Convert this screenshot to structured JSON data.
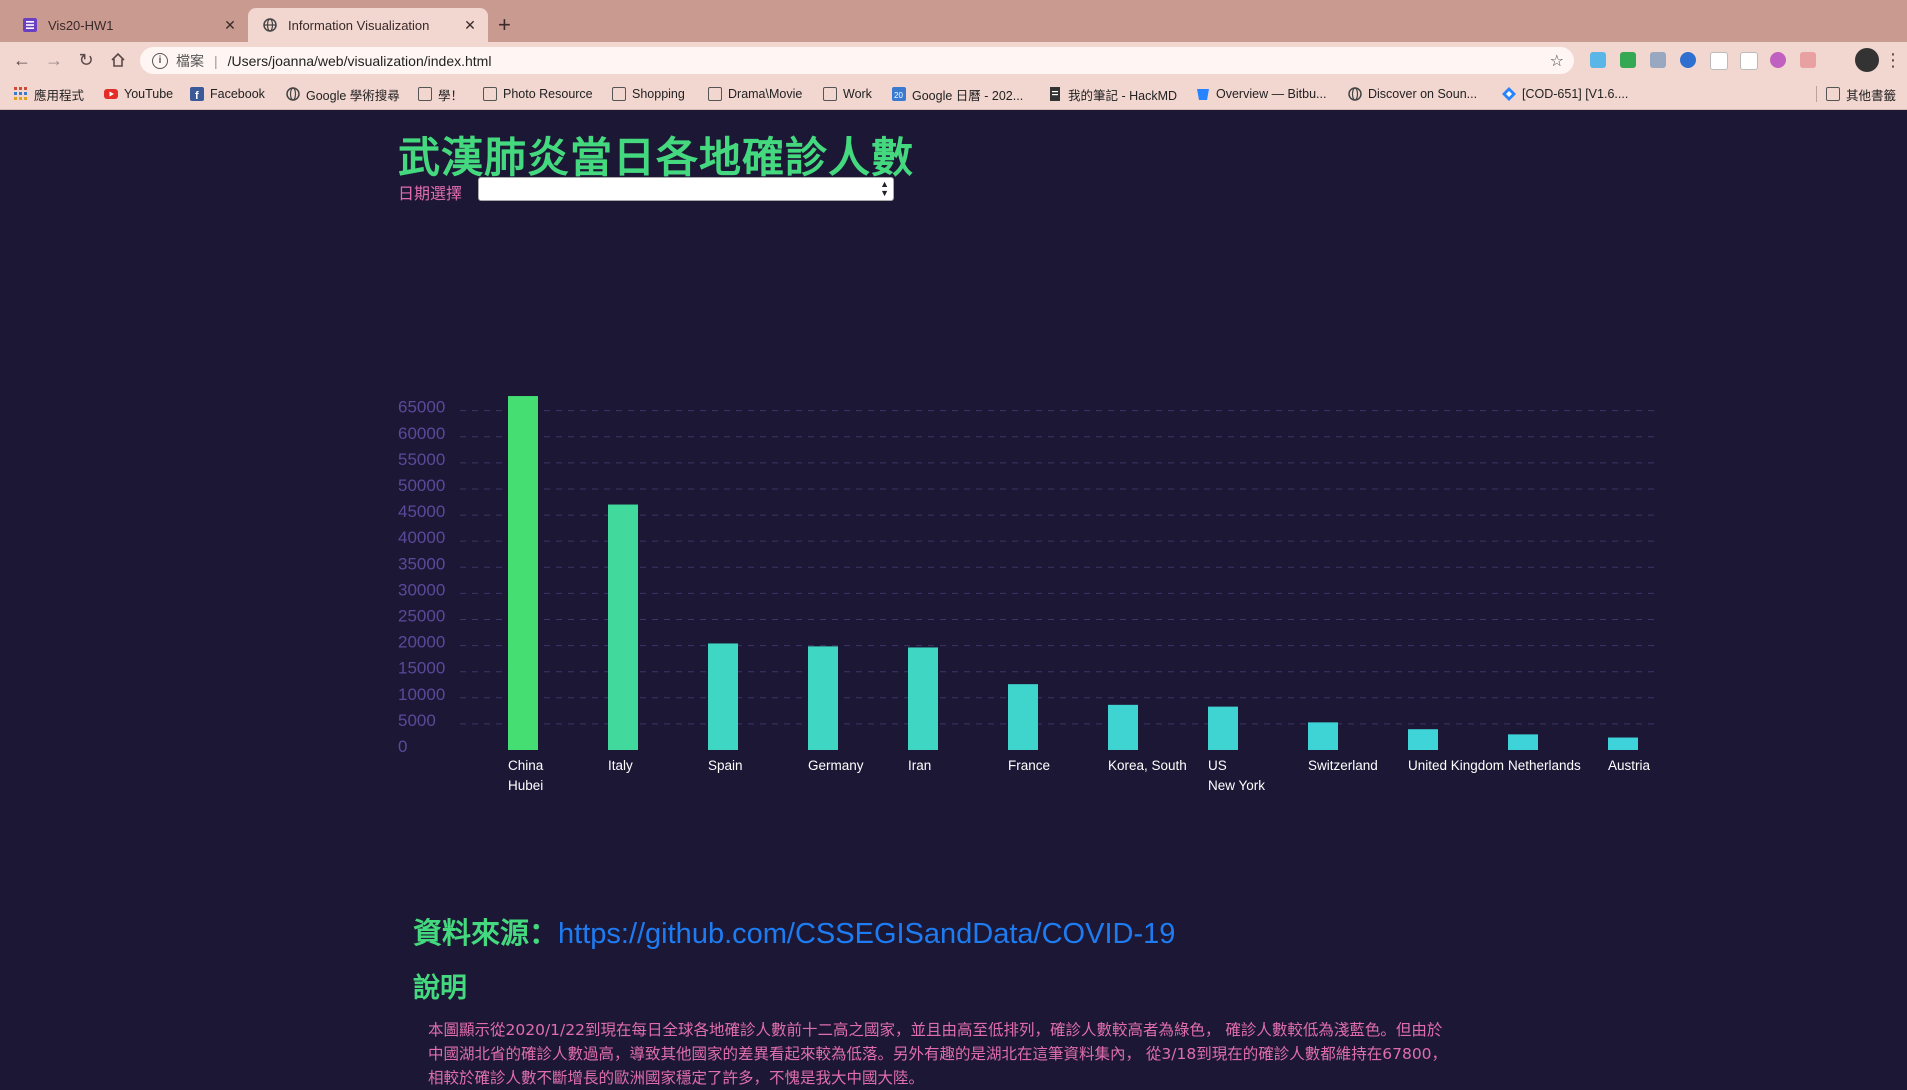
{
  "browser": {
    "tabs": [
      {
        "title": "Vis20-HW1",
        "active": false
      },
      {
        "title": "Information Visualization",
        "active": true
      }
    ],
    "address": {
      "scheme": "檔案",
      "url": "/Users/joanna/web/visualization/index.html"
    },
    "bookmarks": [
      {
        "label": "應用程式",
        "icon": "apps-grid-icon"
      },
      {
        "label": "YouTube",
        "icon": "youtube-icon"
      },
      {
        "label": "Facebook",
        "icon": "facebook-icon"
      },
      {
        "label": "Google 學術搜尋",
        "icon": "globe-icon"
      },
      {
        "label": "學！",
        "icon": "folder-icon"
      },
      {
        "label": "Photo Resource",
        "icon": "folder-icon"
      },
      {
        "label": "Shopping",
        "icon": "folder-icon"
      },
      {
        "label": "Drama\\Movie",
        "icon": "folder-icon"
      },
      {
        "label": "Work",
        "icon": "folder-icon"
      },
      {
        "label": "Google 日曆 - 202...",
        "icon": "calendar-icon"
      },
      {
        "label": "我的筆記 - HackMD",
        "icon": "document-icon"
      },
      {
        "label": "Overview — Bitbu...",
        "icon": "bitbucket-icon"
      },
      {
        "label": "Discover on Soun...",
        "icon": "globe-icon"
      },
      {
        "label": "[COD-651] [V1.6....",
        "icon": "jira-icon"
      },
      {
        "label": "其他書籤",
        "icon": "folder-icon"
      }
    ]
  },
  "page": {
    "title": "武漢肺炎當日各地確診人數",
    "date_label": "日期選擇",
    "date_value": "",
    "source_label": "資料來源：",
    "source_link": "https://github.com/CSSEGISandData/COVID-19",
    "desc_heading": "說明",
    "desc_lines": [
      "本圖顯示從2020/1/22到現在每日全球各地確診人數前十二高之國家，並且由高至低排列，確診人數較高者為綠色， 確診人數較低為淺藍色。但由於",
      "中國湖北省的確診人數過高，導致其他國家的差異看起來較為低落。另外有趣的是湖北在這筆資料集內， 從3/18到現在的確診人數都維持在67800，",
      "相較於確診人數不斷增長的歐洲國家穩定了許多，不愧是我大中國大陸。"
    ]
  },
  "chart_data": {
    "type": "bar",
    "ylim": [
      0,
      68000
    ],
    "yticks": [
      0,
      5000,
      10000,
      15000,
      20000,
      25000,
      30000,
      35000,
      40000,
      45000,
      50000,
      55000,
      60000,
      65000
    ],
    "grid": true,
    "colors": {
      "high": "#44de73",
      "low": "#3ed3dd",
      "grid": "#3c3566"
    },
    "bars": [
      {
        "country": "China",
        "region": "Hubei",
        "value": 67800
      },
      {
        "country": "Italy",
        "region": "",
        "value": 47021
      },
      {
        "country": "Spain",
        "region": "",
        "value": 20410
      },
      {
        "country": "Germany",
        "region": "",
        "value": 19848
      },
      {
        "country": "Iran",
        "region": "",
        "value": 19644
      },
      {
        "country": "France",
        "region": "",
        "value": 12612
      },
      {
        "country": "Korea, South",
        "region": "",
        "value": 8652
      },
      {
        "country": "US",
        "region": "New York",
        "value": 8310
      },
      {
        "country": "Switzerland",
        "region": "",
        "value": 5294
      },
      {
        "country": "United Kingdom",
        "region": "",
        "value": 3983
      },
      {
        "country": "Netherlands",
        "region": "",
        "value": 2994
      },
      {
        "country": "Austria",
        "region": "",
        "value": 2388
      }
    ]
  }
}
